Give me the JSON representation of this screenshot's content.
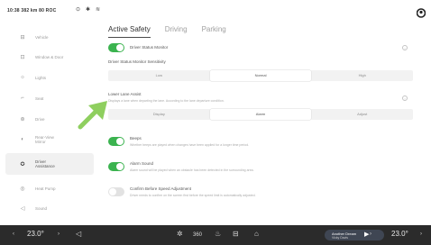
{
  "status": {
    "time_text": "10:38  382 km  80 ROC"
  },
  "sidebar": {
    "items": [
      {
        "label": "Vehicle",
        "icon": "car-icon"
      },
      {
        "label": "Window & Door",
        "icon": "window-icon"
      },
      {
        "label": "Lights",
        "icon": "lights-icon"
      },
      {
        "label": "Seat",
        "icon": "seat-icon"
      },
      {
        "label": "Drive",
        "icon": "steering-icon"
      },
      {
        "label": "Rear-View\nMirror",
        "icon": "mirror-icon"
      },
      {
        "label": "Driver\nAssistance",
        "icon": "driver-assist-icon"
      },
      {
        "label": "Heat Pump",
        "icon": "heat-pump-icon"
      },
      {
        "label": "Sound",
        "icon": "sound-icon"
      }
    ]
  },
  "tabs": [
    {
      "label": "Active Safety"
    },
    {
      "label": "Driving"
    },
    {
      "label": "Parking"
    }
  ],
  "settings": {
    "driver_status_monitor": {
      "title": "Driver Status Monitor"
    },
    "sensitivity": {
      "title": "Driver Status Monitor Sensitivity",
      "options": [
        "Low",
        "Normal",
        "High"
      ],
      "selected": 1
    },
    "lka": {
      "title": "Lower Lane Assist",
      "desc": "Displays a lane when departing the lane. According to the lane departure condition.",
      "options": [
        "Display",
        "Alarm",
        "Adjust"
      ],
      "selected": 1
    },
    "beeps": {
      "title": "Beeps",
      "desc": "Whether beeps are played when changes have been applied for a longer time period."
    },
    "alarm_sound": {
      "title": "Alarm Sound",
      "desc": "Alarm sound will be played when an obstacle has been detected in the surrounding area."
    },
    "speed_adjust": {
      "title": "Confirm Before Speed Adjustment",
      "desc": "Driver needs to confirm on the screen first before the speed limit is automatically adjusted."
    }
  },
  "bottom_bar": {
    "left_temp": "23.0°",
    "right_temp": "23.0°",
    "media_title": "Another Dream",
    "media_sub": "Vicky Davis"
  },
  "colors": {
    "accent_green": "#3bb34f",
    "arrow_green": "#8fcf5f",
    "bar_bg": "#2b2b2b"
  }
}
